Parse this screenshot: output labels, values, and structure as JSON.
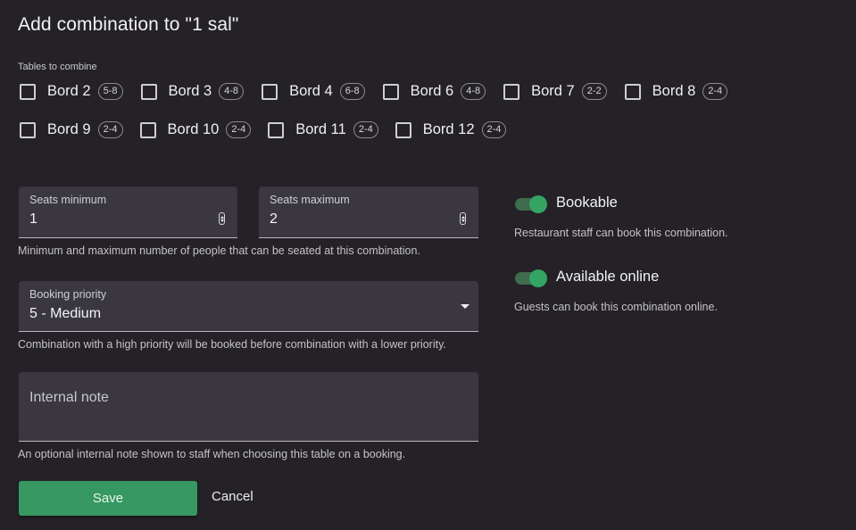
{
  "dialog": {
    "title": "Add combination to \"1 sal\""
  },
  "tables_section": {
    "label": "Tables to combine",
    "row1": [
      {
        "name": "Bord 2",
        "capacity": "5-8",
        "checked": false
      },
      {
        "name": "Bord 3",
        "capacity": "4-8",
        "checked": false
      },
      {
        "name": "Bord 4",
        "capacity": "6-8",
        "checked": false
      },
      {
        "name": "Bord 6",
        "capacity": "4-8",
        "checked": false
      },
      {
        "name": "Bord 7",
        "capacity": "2-2",
        "checked": false
      },
      {
        "name": "Bord 8",
        "capacity": "2-4",
        "checked": false
      }
    ],
    "row2": [
      {
        "name": "Bord 9",
        "capacity": "2-4",
        "checked": false
      },
      {
        "name": "Bord 10",
        "capacity": "2-4",
        "checked": false
      },
      {
        "name": "Bord 11",
        "capacity": "2-4",
        "checked": false
      },
      {
        "name": "Bord 12",
        "capacity": "2-4",
        "checked": false
      }
    ]
  },
  "seats": {
    "min_label": "Seats minimum",
    "min_value": "1",
    "max_label": "Seats maximum",
    "max_value": "2",
    "helper": "Minimum and maximum number of people that can be seated at this combination."
  },
  "priority": {
    "label": "Booking priority",
    "selected": "5 - Medium",
    "helper": "Combination with a high priority will be booked before combination with a lower priority."
  },
  "note": {
    "label": "Internal note",
    "helper": "An optional internal note shown to staff when choosing this table on a booking."
  },
  "bookable": {
    "label": "Bookable",
    "helper": "Restaurant staff can book this combination.",
    "on": true
  },
  "online": {
    "label": "Available online",
    "helper": "Guests can book this combination online.",
    "on": true
  },
  "actions": {
    "save": "Save",
    "cancel": "Cancel"
  },
  "colors": {
    "background": "#242127",
    "field": "#3a3740",
    "accent": "#369760",
    "toggle_on": "#34a463"
  }
}
